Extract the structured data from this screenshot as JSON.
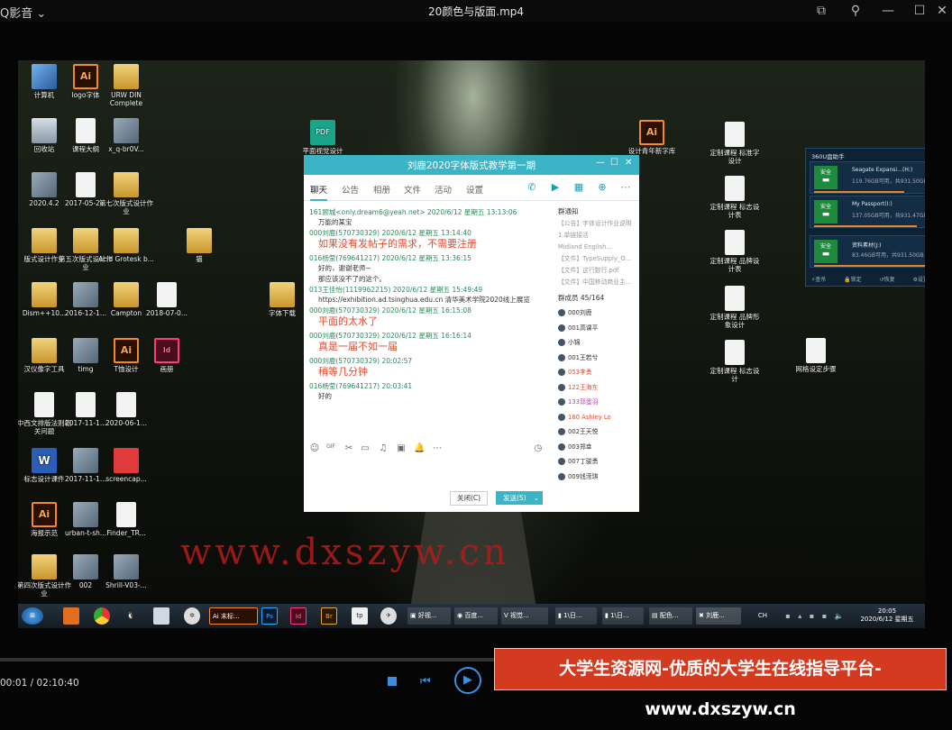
{
  "player": {
    "app_name": "Q影音",
    "video_title": "20颜色与版面.mp4",
    "time": "00:01 / 02:10:40"
  },
  "desktop_icons": [
    {
      "label": "计算机",
      "kind": "pc"
    },
    {
      "label": "logo字体",
      "kind": "ai"
    },
    {
      "label": "URW DIN Complete",
      "kind": "folder"
    },
    {
      "label": "回收站",
      "kind": "bin"
    },
    {
      "label": "课程大纲",
      "kind": "doc"
    },
    {
      "label": "x_q-br0V...",
      "kind": "img"
    },
    {
      "label": "2020.4.2",
      "kind": "img"
    },
    {
      "label": "2017-05-2...",
      "kind": "doc"
    },
    {
      "label": "第七次版式设计作业",
      "kind": "folder"
    },
    {
      "label": "版式设计作业",
      "kind": "folder"
    },
    {
      "label": "第五次版式设计作业",
      "kind": "folder"
    },
    {
      "label": "Acid Grotesk b...",
      "kind": "folder"
    },
    {
      "label": "Dism++10...",
      "kind": "folder"
    },
    {
      "label": "2016-12-1...",
      "kind": "img"
    },
    {
      "label": "Campton",
      "kind": "folder"
    },
    {
      "label": "2018-07-0...",
      "kind": "doc"
    },
    {
      "label": "汉仪像字工具",
      "kind": "folder"
    },
    {
      "label": "timg",
      "kind": "img"
    },
    {
      "label": "T恤设计",
      "kind": "ai"
    },
    {
      "label": "画册",
      "kind": "id"
    },
    {
      "label": "中西文排版法则相关问题",
      "kind": "doc"
    },
    {
      "label": "2017-11-1...",
      "kind": "doc"
    },
    {
      "label": "2020-06-1...",
      "kind": "doc"
    },
    {
      "label": "标志设计课件",
      "kind": "word"
    },
    {
      "label": "2017-11-1...",
      "kind": "img"
    },
    {
      "label": "screencap...",
      "kind": "red"
    },
    {
      "label": "海报示范",
      "kind": "ai"
    },
    {
      "label": "urban-t-sh...",
      "kind": "img"
    },
    {
      "label": "Finder_TR...",
      "kind": "doc"
    },
    {
      "label": "第四次版式设计作业",
      "kind": "folder"
    },
    {
      "label": "002",
      "kind": "img"
    },
    {
      "label": "Shrill-V03-...",
      "kind": "img"
    },
    {
      "label": "平面视觉设计",
      "kind": "pdf"
    },
    {
      "label": "猫",
      "kind": "folder"
    },
    {
      "label": "字体下载",
      "kind": "folder"
    },
    {
      "label": "设计青年新字库",
      "kind": "ai"
    },
    {
      "label": "定制课程 标准字设计",
      "kind": "doc"
    },
    {
      "label": "定制课程 标志设计表",
      "kind": "doc"
    },
    {
      "label": "定制课程 品牌设计表",
      "kind": "doc"
    },
    {
      "label": "定制课程 品牌形象设计",
      "kind": "doc"
    },
    {
      "label": "定制课程 标志设计",
      "kind": "doc"
    },
    {
      "label": "网格设定步骤",
      "kind": "doc"
    }
  ],
  "chat": {
    "title": "刘鹿2020字体版式教学第一期",
    "tabs": [
      "聊天",
      "公告",
      "相册",
      "文件",
      "活动",
      "设置"
    ],
    "messages": [
      {
        "header": "161顾城<only.dream6@yeah.net> 2020/6/12 星期五 13:13:06",
        "body": "万能的某宝",
        "big": false
      },
      {
        "header": "000刘鹿(570730329) 2020/6/12 星期五 13:14:40",
        "body": "如果没有发帖子的需求，不需要注册",
        "big": true
      },
      {
        "header": "016杨莹(769641217) 2020/6/12 星期五 13:36:15",
        "body": "好的，谢谢老师~",
        "body2": "那应该没不了的这个。",
        "big": false
      },
      {
        "header": "013王佳怡(1119962215) 2020/6/12 星期五 15:49:49",
        "body": "https://exhibition.ad.tsinghua.edu.cn 清华美术学院2020线上展览",
        "big": false
      },
      {
        "header": "000刘鹿(570730329) 2020/6/12 星期五 16:15:08",
        "body": "平面的太水了",
        "big": true
      },
      {
        "header": "000刘鹿(570730329) 2020/6/12 星期五 16:16:14",
        "body": "真是一届不如一届",
        "big": true
      },
      {
        "header": "000刘鹿(570730329) 20:02:57",
        "body": "稍等几分钟",
        "big": true
      },
      {
        "header": "016杨莹(769641217) 20:03:41",
        "body": "好的",
        "big": false
      }
    ],
    "notice_title": "群通知",
    "notices": [
      "【公告】字体设计作业说明",
      "1.单链接活",
      "Midland English...",
      "【文件】TypeSupply_O...",
      "【文件】这行数行.pdf",
      "【文件】中国移动商业主..."
    ],
    "members_label": "群成员 45/164",
    "members": [
      "000刘鹿",
      "001高课平",
      "小锦",
      "001王若兮",
      "053李勇",
      "122王海东",
      "133郭蛋羽",
      "160 Ashley Lo",
      "002王天悦",
      "003郑幸",
      "007丁骏勇",
      "009钱滢琪"
    ],
    "close_label": "关闭(C)",
    "send_label": "发送(S)"
  },
  "panel360": {
    "title": "360U盘助手",
    "drives": [
      {
        "name": "Seagate Expansi…(H:)",
        "size": "119.76GB可用，共931.50GB",
        "badge": "安全"
      },
      {
        "name": "My Passport(I:)",
        "size": "137.05GB可用，共931.47GB",
        "badge": "安全"
      },
      {
        "name": "资料素材(J:)",
        "size": "83.46GB可用，共931.50GB",
        "badge": "安全"
      }
    ],
    "actions": [
      "查杀",
      "锁定",
      "恢复",
      "设置"
    ]
  },
  "taskbar": {
    "items": [
      "末标...",
      "好视...",
      "百度...",
      "视觉...",
      "1\\日...",
      "1\\日...",
      "配色...",
      "刘鹿..."
    ],
    "clock_time": "20:05",
    "clock_date": "2020/6/12 星期五",
    "lang": "CH"
  },
  "watermark": "www.dxszyw.cn",
  "banner": "大学生资源网-优质的大学生在线指导平台-www.dxszyw.cn"
}
